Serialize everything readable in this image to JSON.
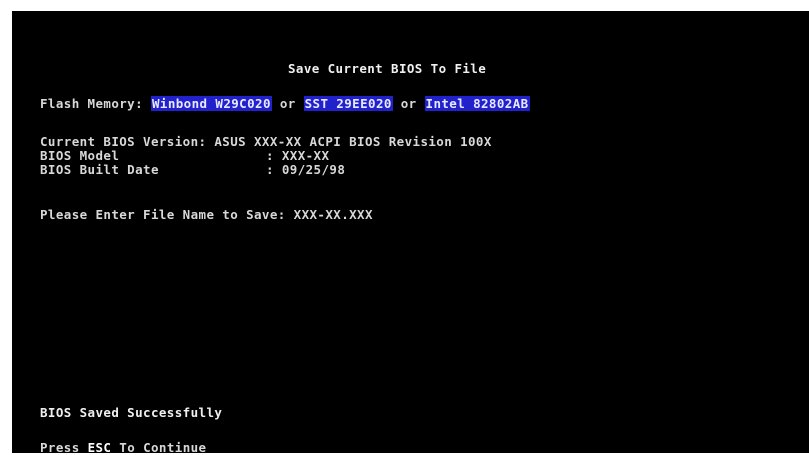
{
  "title": "Save Current BIOS To File",
  "flash": {
    "label": "Flash Memory:",
    "chips": [
      "Winbond W29C020",
      "SST 29EE020",
      "Intel 82802AB"
    ],
    "separator": "or"
  },
  "bios_info": [
    {
      "label": "Current BIOS Version",
      "value": "ASUS XXX-XX ACPI BIOS Revision 100X"
    },
    {
      "label": "BIOS Model",
      "value": "XXX-XX"
    },
    {
      "label": "BIOS Built Date",
      "value": "09/25/98"
    }
  ],
  "prompt": {
    "label": "Please Enter File Name to Save:",
    "value": "XXX-XX.XXX"
  },
  "status": "BIOS Saved Successfully",
  "continue": {
    "prefix": "Press",
    "key": "ESC",
    "suffix": "To Continue"
  },
  "colors": {
    "background": "#000000",
    "text": "#d8d8d8",
    "highlight": "#2222cc"
  }
}
